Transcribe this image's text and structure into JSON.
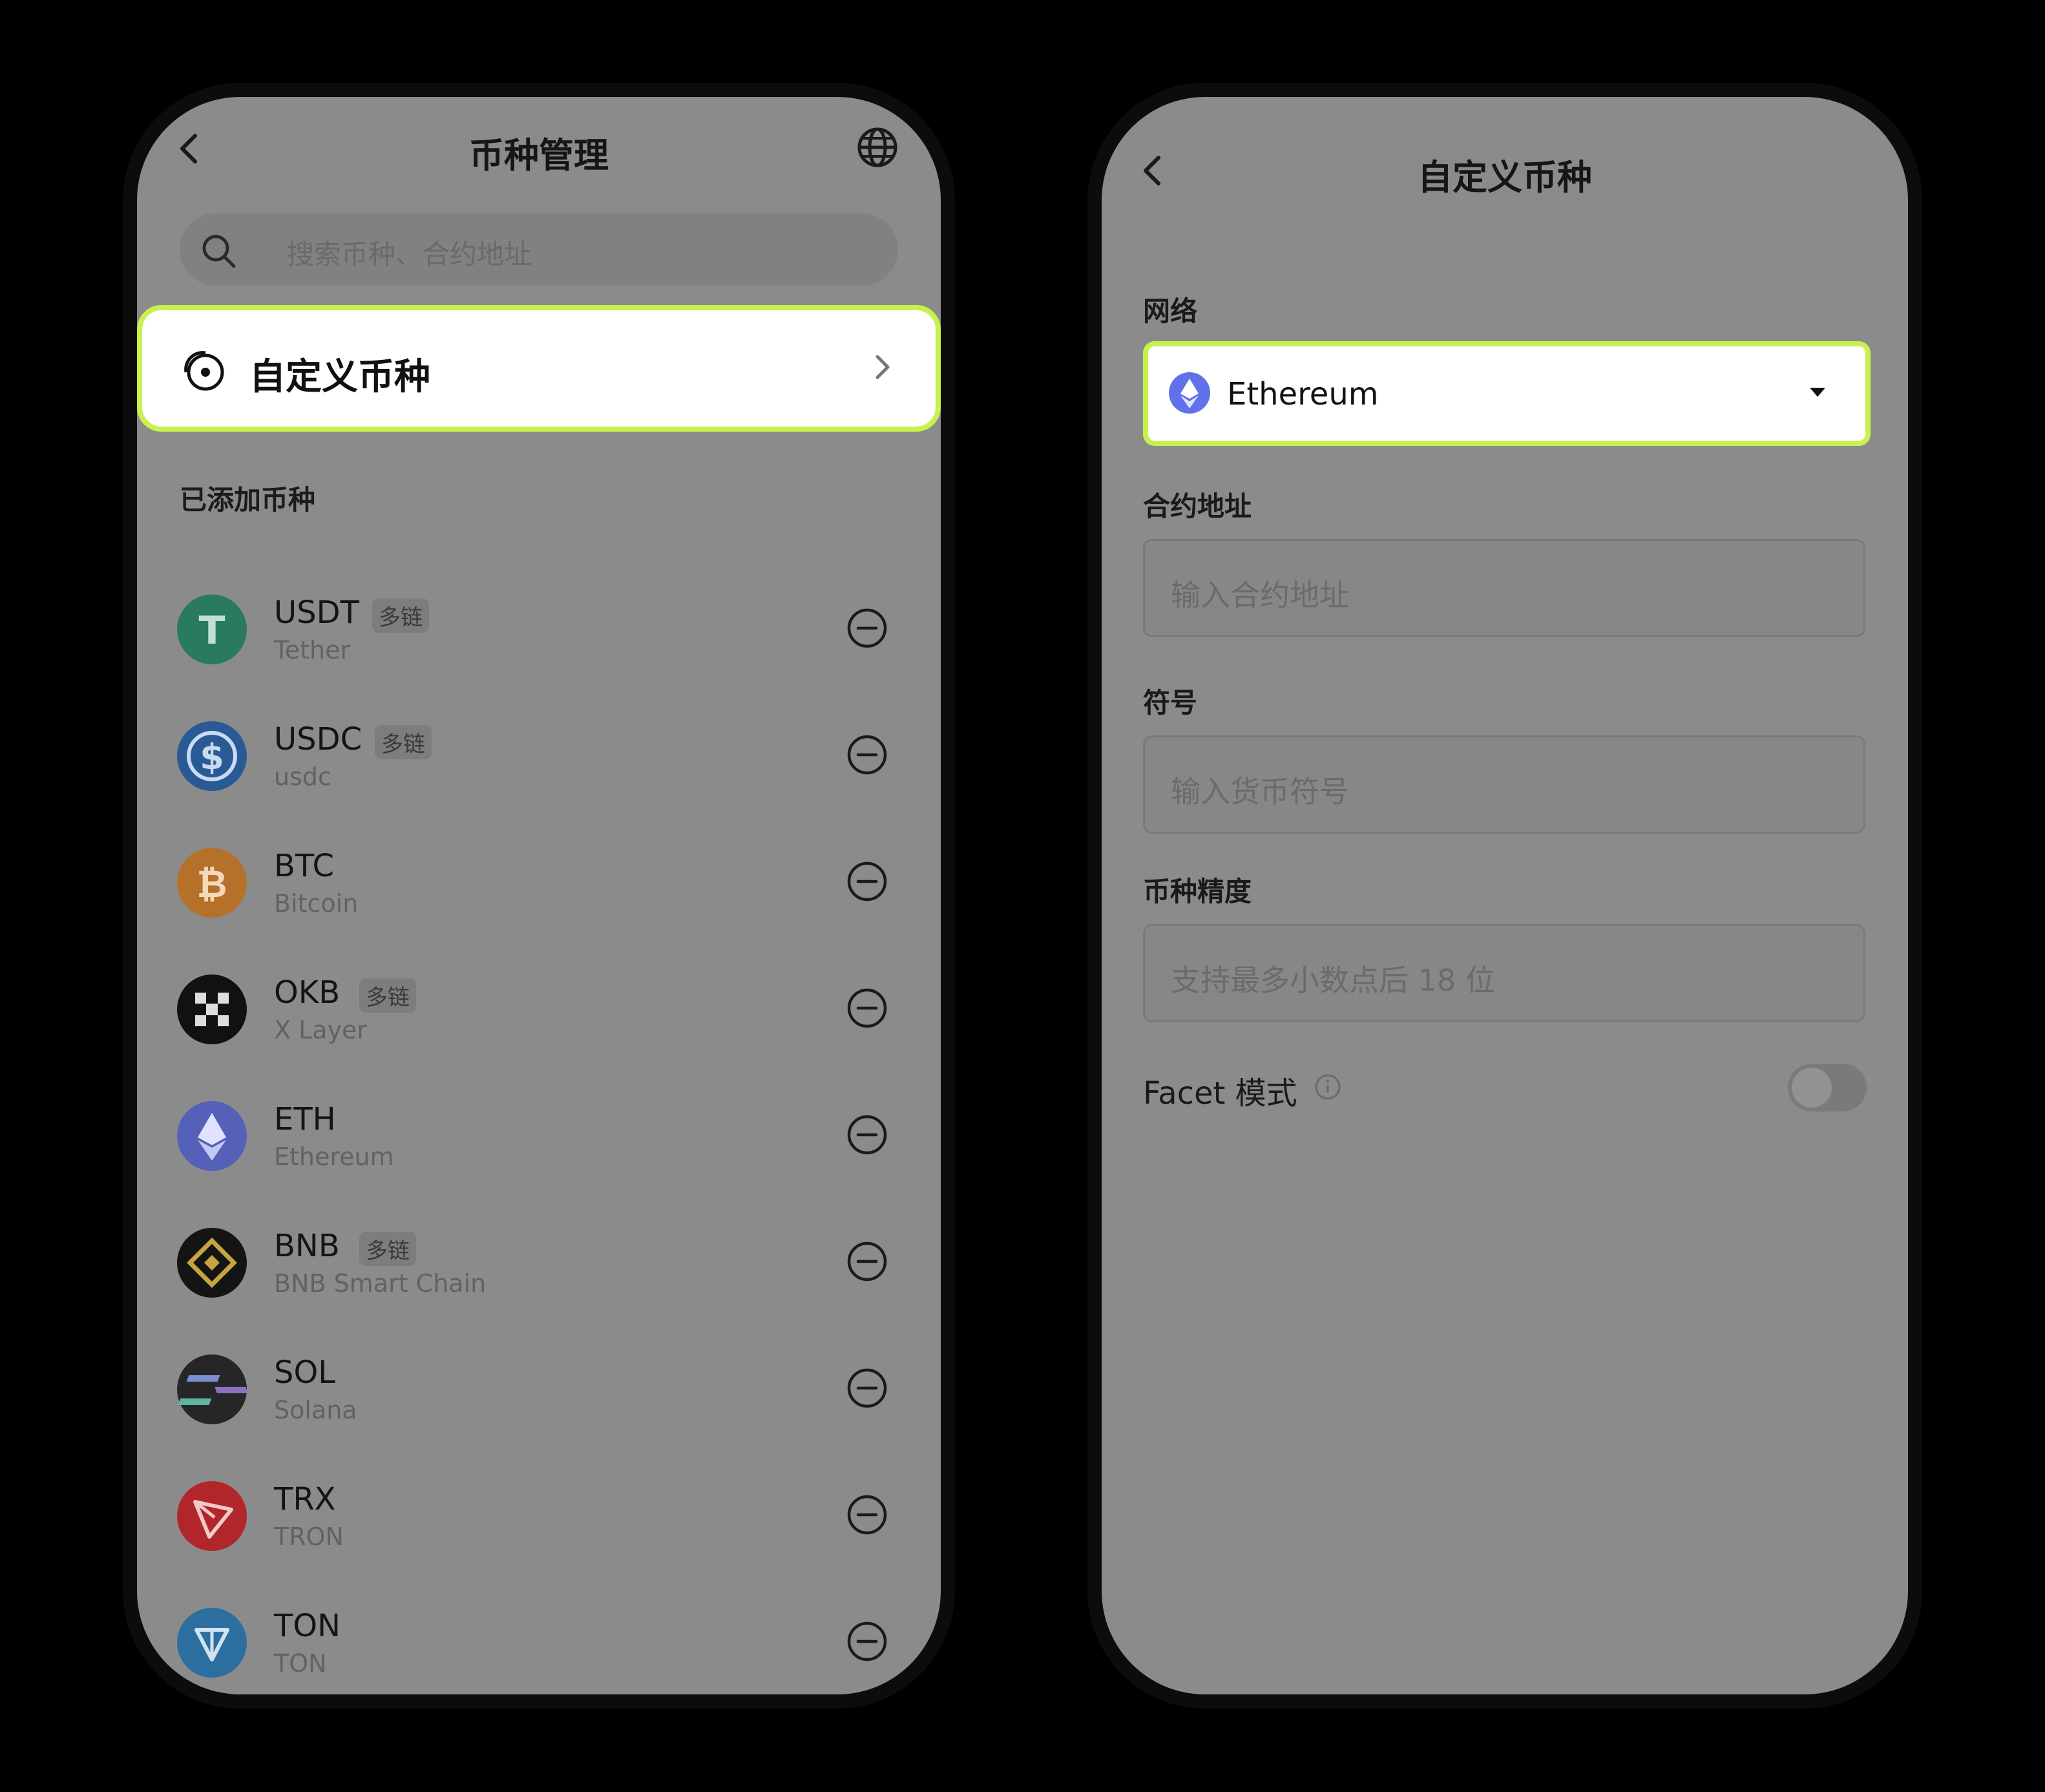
{
  "left_screen": {
    "title": "币种管理",
    "search_placeholder": "搜索币种、合约地址",
    "custom_token_label": "自定义币种",
    "added_section_label": "已添加币种",
    "tokens": [
      {
        "symbol": "USDT",
        "badge": "多链",
        "name": "Tether",
        "color": "#2a7a60"
      },
      {
        "symbol": "USDC",
        "badge": "多链",
        "name": "usdc",
        "color": "#2a5a96"
      },
      {
        "symbol": "BTC",
        "badge": "",
        "name": "Bitcoin",
        "color": "#b5712a"
      },
      {
        "symbol": "OKB",
        "badge": "多链",
        "name": "X Layer",
        "color": "#111111"
      },
      {
        "symbol": "ETH",
        "badge": "",
        "name": "Ethereum",
        "color": "#5560b8"
      },
      {
        "symbol": "BNB",
        "badge": "多链",
        "name": "BNB Smart Chain",
        "color": "#141414"
      },
      {
        "symbol": "SOL",
        "badge": "",
        "name": "Solana",
        "color": "#262626"
      },
      {
        "symbol": "TRX",
        "badge": "",
        "name": "TRON",
        "color": "#b0262a"
      },
      {
        "symbol": "TON",
        "badge": "",
        "name": "TON",
        "color": "#2d6ea0"
      }
    ]
  },
  "right_screen": {
    "title": "自定义币种",
    "network_label": "网络",
    "network_value": "Ethereum",
    "contract_label": "合约地址",
    "contract_placeholder": "输入合约地址",
    "symbol_label": "符号",
    "symbol_placeholder": "输入货币符号",
    "precision_label": "币种精度",
    "precision_placeholder": "支持最多小数点后 18 位",
    "facet_label": "Facet 模式",
    "facet_enabled": false
  },
  "colors": {
    "highlight": "#c7f24e",
    "screen_overlay": "#8b8b8b"
  }
}
